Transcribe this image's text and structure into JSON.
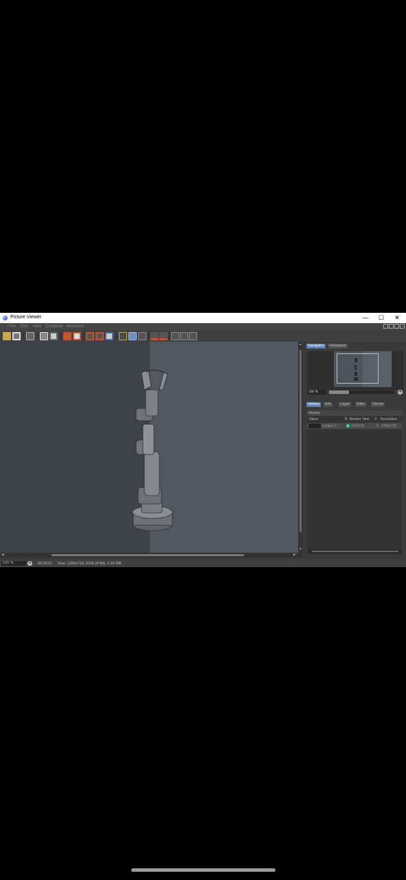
{
  "window": {
    "title": "Picture Viewer",
    "controls": {
      "minimize": "—",
      "maximize": "☐",
      "close": "✕"
    }
  },
  "menu": [
    "File",
    "Edit",
    "View",
    "Compose",
    "Animation"
  ],
  "toolbar": {
    "icons": [
      "open-icon",
      "save-icon",
      "copy-icon",
      "fit-icon",
      "export-icon",
      "render-icon",
      "render-region-icon",
      "region-icon",
      "snapshot-icon",
      "compare-icon",
      "ab-compare-icon",
      "split-view-icon",
      "layout-icon",
      "channel-a-icon",
      "channel-b-icon",
      "grid-icon",
      "grid-alt-icon",
      "frame-icon"
    ]
  },
  "navigator": {
    "tabs": [
      "Navigator",
      "Histogram"
    ],
    "active_tab": "Navigator",
    "zoom": "100 %",
    "zoom_slider_fraction": 0.3
  },
  "panel_tabs": [
    "History",
    "Info",
    "Layer",
    "Filter",
    "Stereo"
  ],
  "active_panel_tab": "History",
  "history": {
    "header": "History",
    "columns": [
      "Name",
      "R",
      "Render Time",
      "F",
      "Resolution"
    ],
    "rows": [
      {
        "name": "Untitled 1 *",
        "render_time": "00:00:01",
        "frame": "0",
        "resolution": "1280x720"
      }
    ]
  },
  "statusbar": {
    "zoom": "100 %",
    "time": "00:00:01",
    "info": "Size: 1280x720, RGB (8 Bit), 2.64 MB"
  },
  "colors": {
    "accent": "#5f7fb3",
    "status_dot": "#3cd3a0",
    "viewport_bg": "#3e434a",
    "render_bg": "#525860"
  }
}
